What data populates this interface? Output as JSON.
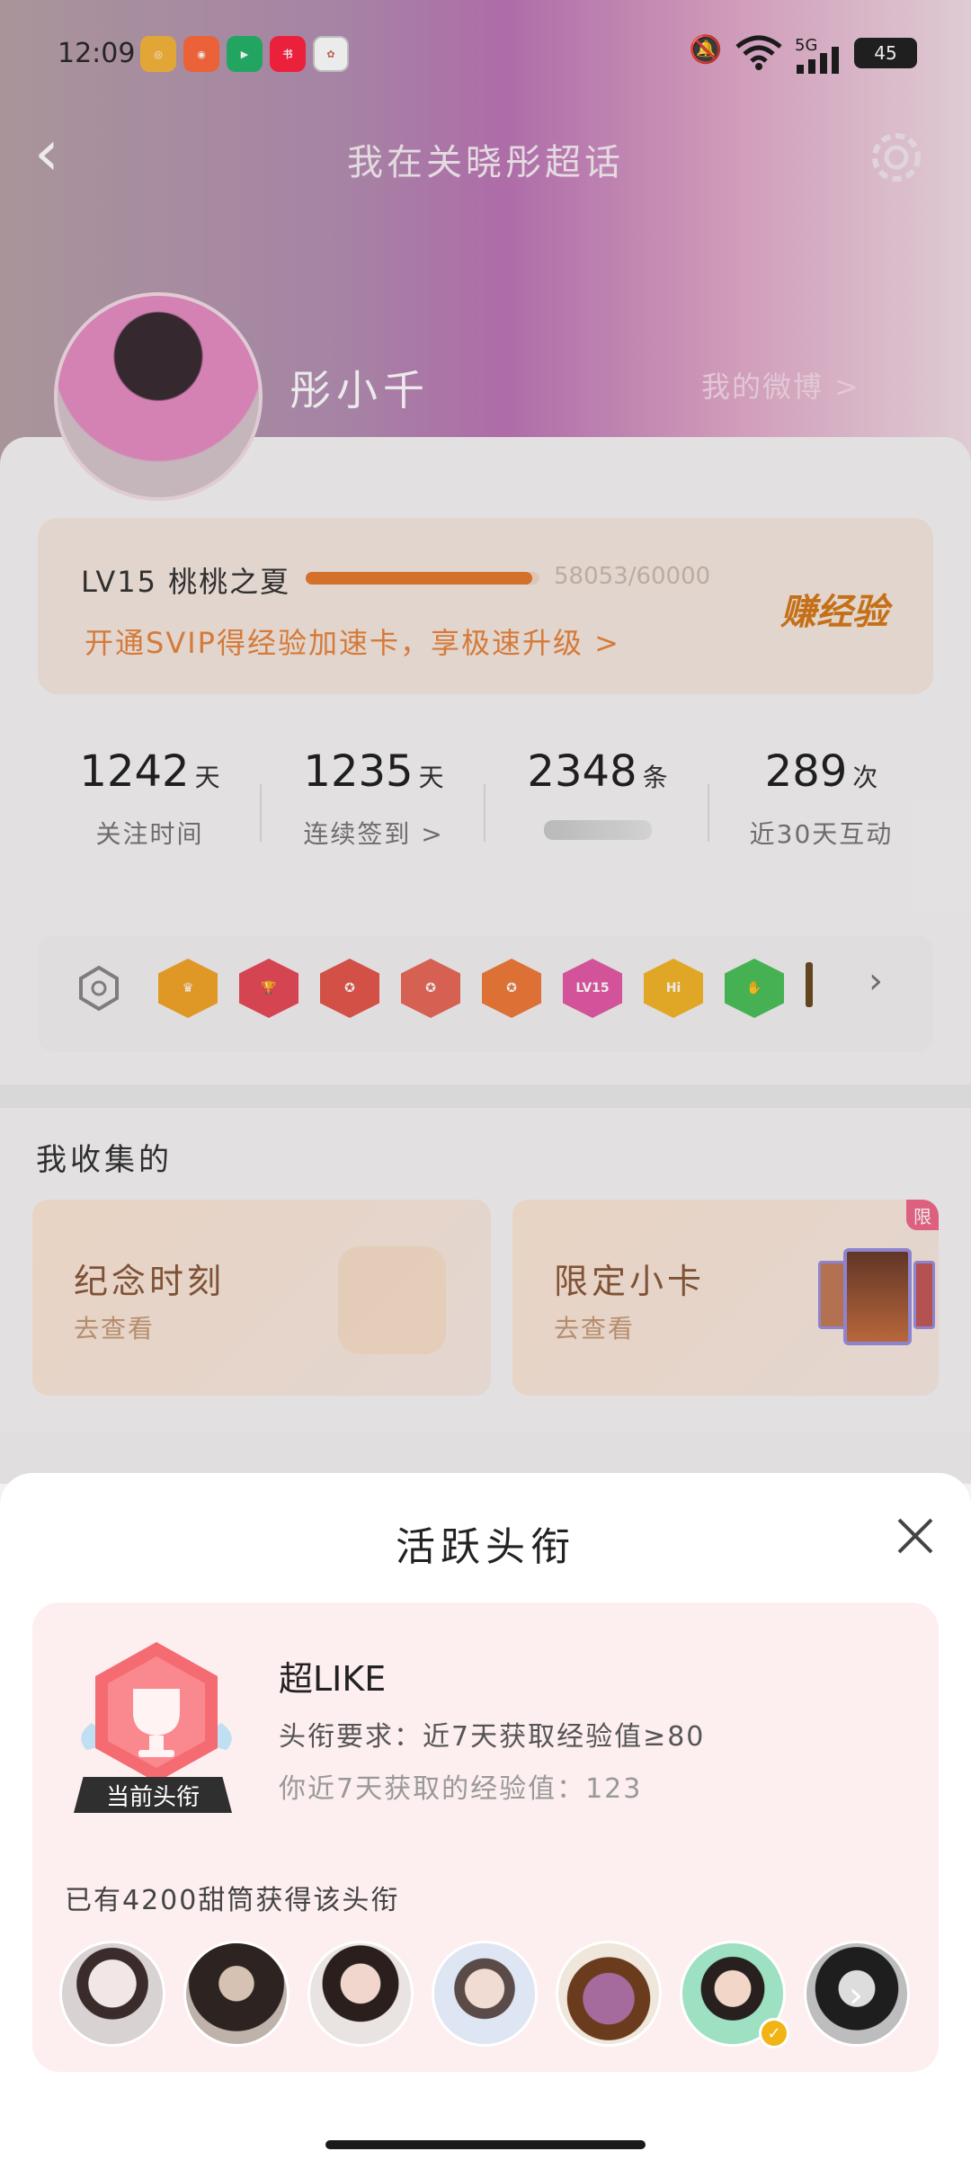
{
  "status": {
    "time": "12:09",
    "network": "5G",
    "battery": "45"
  },
  "nav": {
    "title": "我在关晓彤超话"
  },
  "profile": {
    "name": "彤小千",
    "my_weibo": "我的微博 >"
  },
  "level": {
    "name": "LV15 桃桃之夏",
    "progress_text": "58053/60000",
    "progress": 0.9676,
    "svip_text": "开通SVIP得经验加速卡，享极速升级 >",
    "earn_label": "赚经验"
  },
  "stats": [
    {
      "value": "1242",
      "unit": "天",
      "label": "关注时间"
    },
    {
      "value": "1235",
      "unit": "天",
      "label": "连续签到 >"
    },
    {
      "value": "2348",
      "unit": "条",
      "label": ""
    },
    {
      "value": "289",
      "unit": "次",
      "label": "近30天互动"
    }
  ],
  "badge_labels": [
    "LV15",
    "Hi"
  ],
  "collect": {
    "title": "我收集的",
    "cards": [
      {
        "name": "纪念时刻",
        "sub": "去查看"
      },
      {
        "name": "限定小卡",
        "sub": "去查看",
        "tag": "限"
      }
    ]
  },
  "sheet": {
    "title": "活跃头衔",
    "badge_tag": "当前头衔",
    "title_name": "超LIKE",
    "requirement": "头衔要求：近7天获取经验值≥80",
    "mine": "你近7天获取的经验值：123",
    "owners": "已有4200甜筒获得该头衔"
  },
  "colors": {
    "accent": "#e67a2e",
    "sheet_bg": "#fdeef0"
  }
}
